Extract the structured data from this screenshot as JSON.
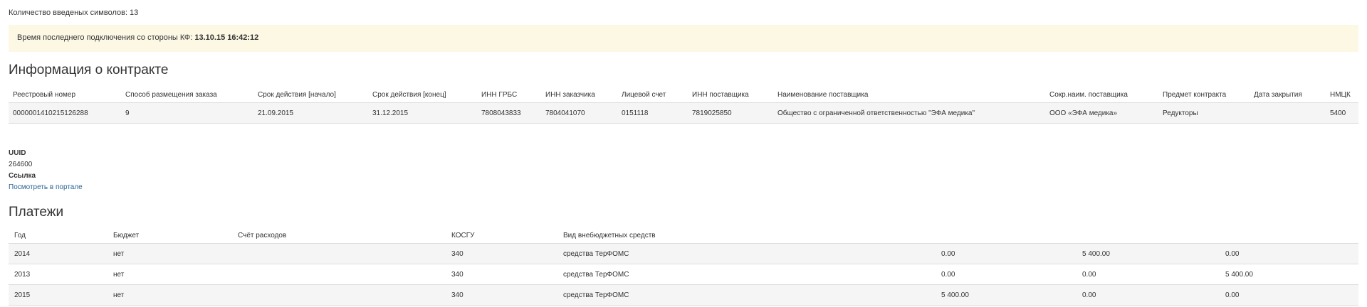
{
  "counter_text": "Количество введеных символов: 13",
  "alert": {
    "prefix": "Время последнего подключения со стороны КФ: ",
    "datetime": "13.10.15 16:42:12"
  },
  "contract": {
    "title": "Информация о контракте",
    "headers": [
      "Реестровый номер",
      "Способ размещения заказа",
      "Срок действия [начало]",
      "Срок действия [конец]",
      "ИНН ГРБС",
      "ИНН заказчика",
      "Лицевой счет",
      "ИНН поставщика",
      "Наименование поставщика",
      "Сокр.наим. поставщика",
      "Предмет контракта",
      "Дата закрытия",
      "НМЦК"
    ],
    "row": [
      "0000001410215126288",
      "9",
      "21.09.2015",
      "31.12.2015",
      "7808043833",
      "7804041070",
      "0151118",
      "7819025850",
      "Общество с ограниченной ответственностью \"ЭФА медика\"",
      "ООО «ЭФА медика»",
      "Редукторы",
      "",
      "5400"
    ]
  },
  "meta": {
    "uuid_label": "UUID",
    "uuid_value": "264600",
    "link_label": "Ссылка",
    "link_text": "Посмотреть в портале"
  },
  "payments": {
    "title": "Платежи",
    "headers": [
      "Год",
      "Бюджет",
      "Счёт расходов",
      "КОСГУ",
      "Вид внебюджетных средств",
      "",
      "",
      ""
    ],
    "rows": [
      [
        "2014",
        "нет",
        "",
        "340",
        "средства ТерФОМС",
        "0.00",
        "5 400.00",
        "0.00"
      ],
      [
        "2013",
        "нет",
        "",
        "340",
        "средства ТерФОМС",
        "0.00",
        "0.00",
        "5 400.00"
      ],
      [
        "2015",
        "нет",
        "",
        "340",
        "средства ТерФОМС",
        "5 400.00",
        "0.00",
        "0.00"
      ]
    ]
  }
}
